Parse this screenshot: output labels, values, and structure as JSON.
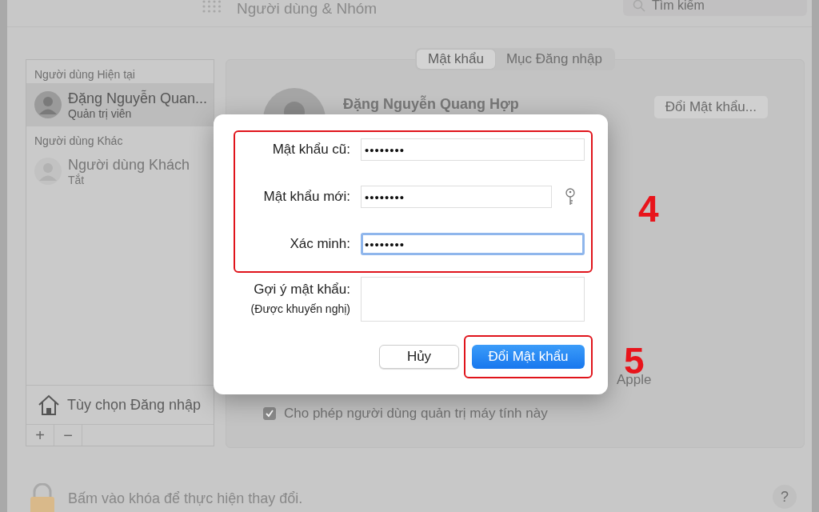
{
  "window": {
    "title": "Người dùng & Nhóm",
    "search": {
      "placeholder": "Tìm kiếm"
    }
  },
  "sidebar": {
    "sections": [
      {
        "header": "Người dùng Hiện tại",
        "users": [
          {
            "name": "Đặng Nguyễn Quan...",
            "role": "Quản trị viên",
            "selected": true,
            "disabled": false
          }
        ]
      },
      {
        "header": "Người dùng Khác",
        "users": [
          {
            "name": "Người dùng Khách",
            "role": "Tắt",
            "selected": false,
            "disabled": true
          }
        ]
      }
    ],
    "login_options": "Tùy chọn Đăng nhập",
    "add_button": "+",
    "remove_button": "−"
  },
  "tabs": [
    {
      "label": "Mật khẩu",
      "selected": true
    },
    {
      "label": "Mục Đăng nhập",
      "selected": false
    }
  ],
  "user": {
    "name": "Đặng Nguyễn Quang Hợp",
    "change_password_button": "Đổi Mật khẩu..."
  },
  "options": [
    {
      "kind": "text",
      "label": "Apple"
    },
    {
      "kind": "checkbox",
      "label": "Cho phép người dùng quản trị máy tính này",
      "checked": true
    }
  ],
  "lock": {
    "text": "Bấm vào khóa để thực hiện thay đổi."
  },
  "help_button": "?",
  "dialog": {
    "fields": [
      {
        "label": "Mật khẩu cũ:",
        "value": "••••••••",
        "focused": false,
        "key_button": false
      },
      {
        "label": "Mật khẩu mới:",
        "value": "••••••••",
        "focused": false,
        "key_button": true
      },
      {
        "label": "Xác minh:",
        "value": "••••••••",
        "focused": true,
        "key_button": false
      }
    ],
    "hint": {
      "label": "Gợi ý mật khẩu:",
      "sublabel": "(Được khuyến nghị)"
    },
    "buttons": [
      {
        "kind": "default",
        "label": "Hủy"
      },
      {
        "kind": "primary",
        "label": "Đổi Mật khẩu"
      }
    ]
  },
  "annotations": [
    {
      "label": "4"
    },
    {
      "label": "5"
    }
  ]
}
